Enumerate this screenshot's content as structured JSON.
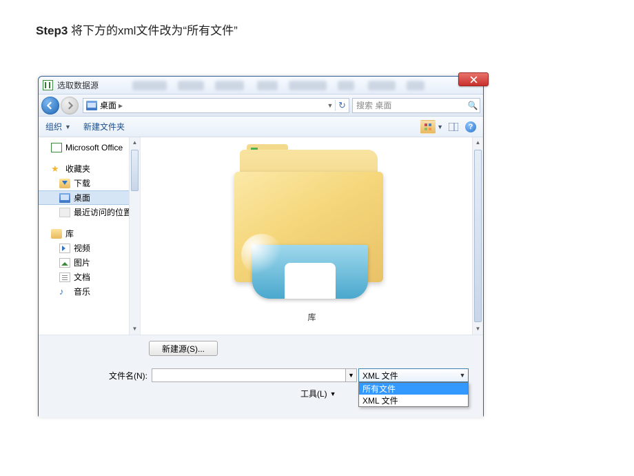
{
  "caption": {
    "step": "Step3",
    "text": "  将下方的xml文件改为“所有文件”"
  },
  "window": {
    "title": "选取数据源"
  },
  "nav": {
    "breadcrumb_location": "桌面",
    "breadcrumb_sep": "▸",
    "refresh_glyph": "↻",
    "search_placeholder": "搜索 桌面",
    "search_icon_glyph": "🔍"
  },
  "toolbar": {
    "organize": "组织",
    "new_folder": "新建文件夹",
    "help_glyph": "?"
  },
  "sidebar": {
    "items": [
      {
        "label": "Microsoft Office",
        "icon": "excel",
        "level": 1
      },
      {
        "label": "",
        "spacer": true
      },
      {
        "label": "收藏夹",
        "icon": "star",
        "level": 1
      },
      {
        "label": "下载",
        "icon": "dl",
        "level": 2
      },
      {
        "label": "桌面",
        "icon": "desktop",
        "level": 2,
        "selected": true
      },
      {
        "label": "最近访问的位置",
        "icon": "recent",
        "level": 2
      },
      {
        "label": "",
        "spacer": true
      },
      {
        "label": "库",
        "icon": "lib",
        "level": 1
      },
      {
        "label": "视频",
        "icon": "video",
        "level": 2
      },
      {
        "label": "图片",
        "icon": "pic",
        "level": 2
      },
      {
        "label": "文档",
        "icon": "doc",
        "level": 2
      },
      {
        "label": "音乐",
        "icon": "music",
        "level": 2
      }
    ]
  },
  "content": {
    "item_label": "库"
  },
  "footer": {
    "new_source": "新建源(S)...",
    "filename_label": "文件名(N):",
    "filename_value": "",
    "filter_current": "XML 文件",
    "filter_options": [
      "所有文件",
      "XML 文件"
    ],
    "filter_selected_index": 0,
    "tools_label": "工具(L)"
  }
}
